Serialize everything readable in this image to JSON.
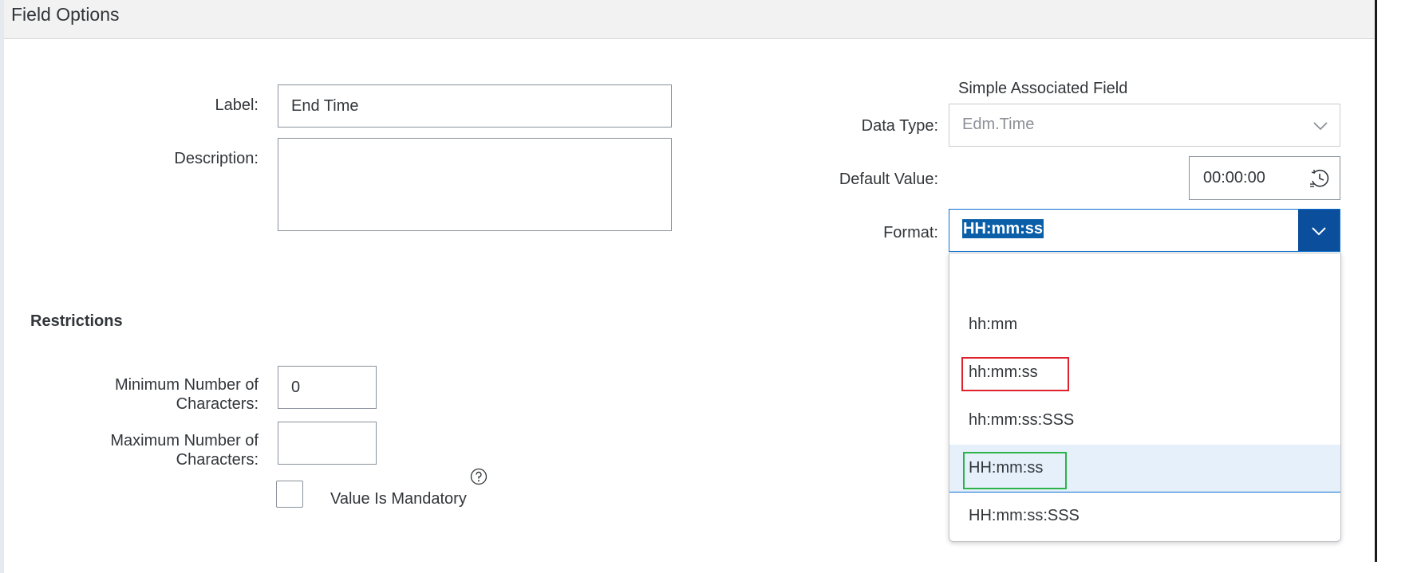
{
  "header": {
    "title": "Field Options"
  },
  "form": {
    "label_label": "Label:",
    "label_value": "End Time",
    "description_label": "Description:",
    "description_value": ""
  },
  "associated": {
    "heading": "Simple Associated Field",
    "data_type_label": "Data Type:",
    "data_type_value": "Edm.Time",
    "default_value_label": "Default Value:",
    "default_value": "00:00:00",
    "format_label": "Format:",
    "format_value": "HH:mm:ss",
    "format_options": [
      "",
      "hh:mm",
      "hh:mm:ss",
      "hh:mm:ss:SSS",
      "HH:mm:ss",
      "HH:mm:ss:SSS"
    ],
    "selected_option": "HH:mm:ss"
  },
  "restrictions": {
    "title": "Restrictions",
    "min_label_line1": "Minimum Number of",
    "min_label_line2": "Characters:",
    "min_value": "0",
    "max_label_line1": "Maximum Number of",
    "max_label_line2": "Characters:",
    "max_value": "",
    "mandatory_label": "Value Is Mandatory",
    "mandatory_checked": false
  },
  "icons": {
    "chevron": "chevron-down-icon",
    "time": "time-picker-icon",
    "help": "help-icon"
  },
  "colors": {
    "accent": "#0a6ed1",
    "button_bg": "#0b4f9c",
    "selected_item_bg": "#e5f0fa",
    "highlight_red": "#e0202b",
    "highlight_green": "#2bb34a"
  }
}
